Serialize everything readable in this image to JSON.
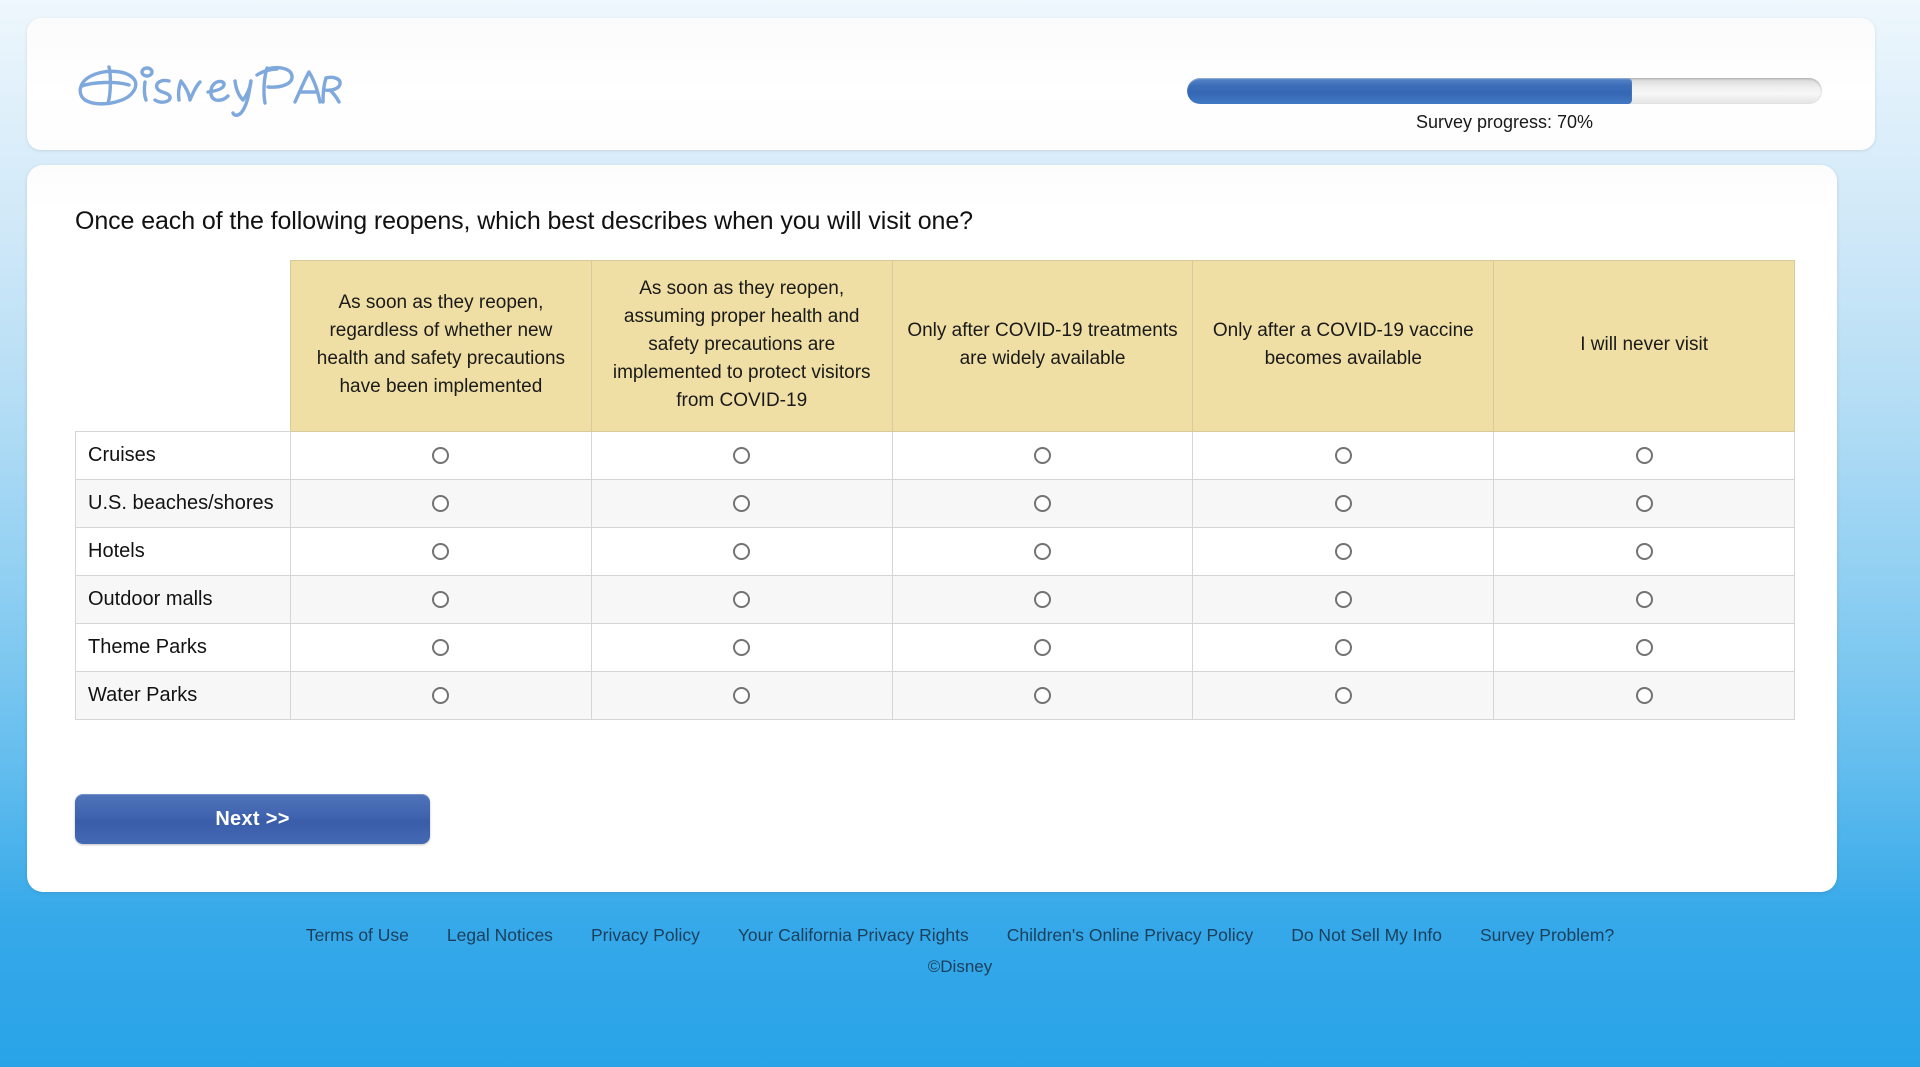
{
  "header": {
    "logo_alt": "Disney Parks",
    "logo_color": "#7fa8dd",
    "progress": {
      "percent": 70,
      "label": "Survey progress: 70%",
      "fill_color": "#3568b4",
      "track_color": "#ececec"
    }
  },
  "main": {
    "question": "Once each of the following reopens, which best describes when you will visit one?",
    "matrix": {
      "header_bg": "#f0dfa4",
      "columns": [
        "As soon as they reopen, regardless of whether new health and safety precautions have been implemented",
        "As soon as they reopen, assuming proper health and safety precautions are implemented to protect visitors from COVID-19",
        "Only after COVID-19 treatments are widely available",
        "Only after a COVID-19 vaccine becomes available",
        "I will never visit"
      ],
      "rows": [
        "Cruises",
        "U.S. beaches/shores",
        "Hotels",
        "Outdoor malls",
        "Theme Parks",
        "Water Parks"
      ],
      "selected": [
        null,
        null,
        null,
        null,
        null,
        null
      ]
    },
    "next_label": "Next >>"
  },
  "footer": {
    "links": [
      "Terms of Use",
      "Legal Notices",
      "Privacy Policy",
      "Your California Privacy Rights",
      "Children's Online Privacy Policy",
      "Do Not Sell My Info",
      "Survey Problem?"
    ],
    "copyright": "©Disney"
  }
}
